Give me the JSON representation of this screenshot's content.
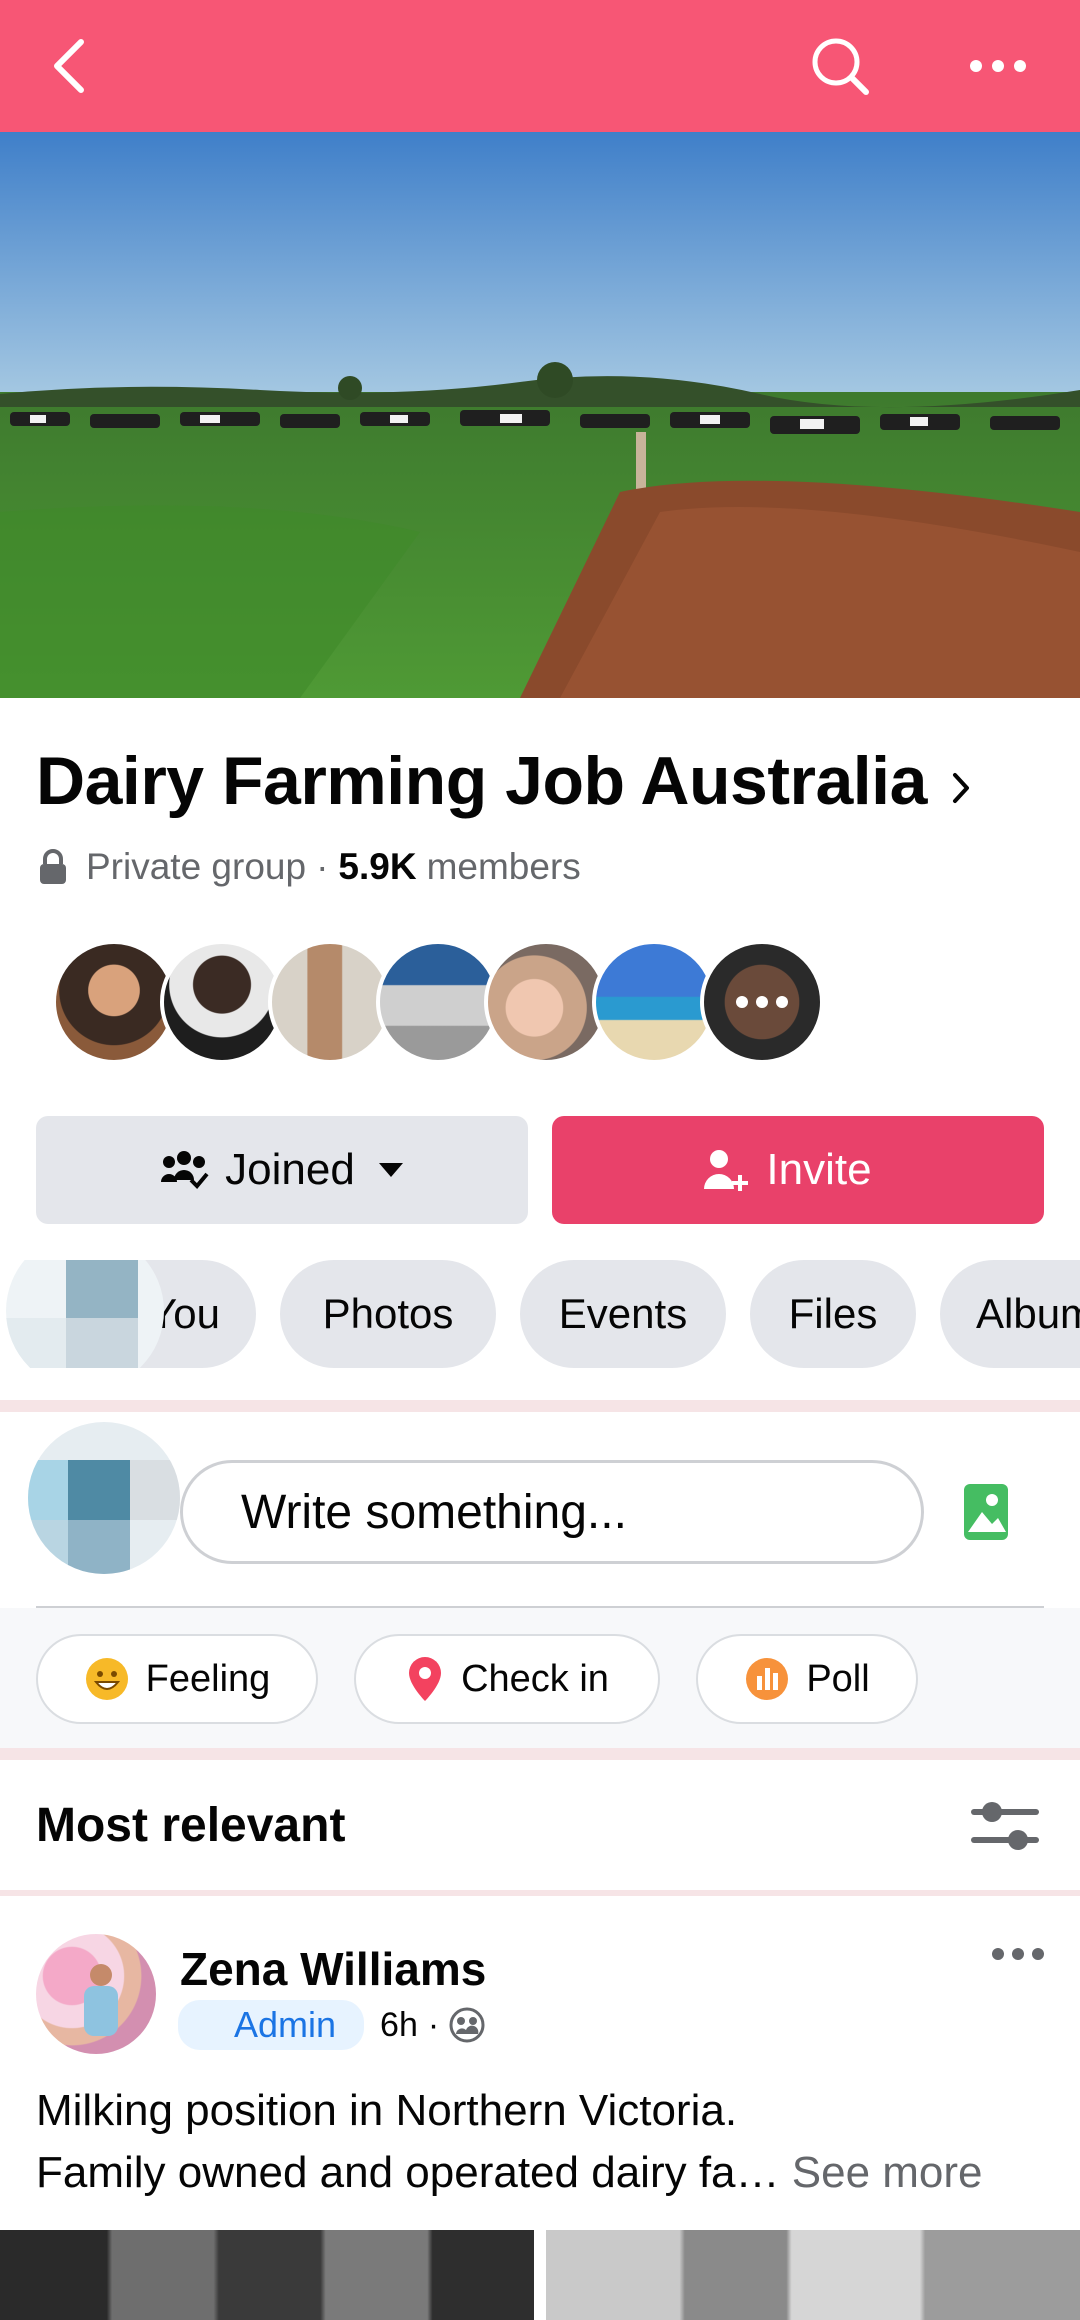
{
  "topbar": {
    "back_icon": "back-arrow-icon",
    "search_icon": "search-icon",
    "more_icon": "more-dots-icon",
    "color": "#f75675"
  },
  "group": {
    "name": "Dairy Farming Job Australia",
    "privacy": "Private group",
    "separator": "·",
    "member_count": "5.9K",
    "members_label": "members"
  },
  "member_avatars": {
    "count_shown": 7,
    "more_icon": "more-dots-icon"
  },
  "actions": {
    "joined_label": "Joined",
    "invite_label": "Invite",
    "accent_color": "#e9416a"
  },
  "tabs": [
    {
      "label": "You"
    },
    {
      "label": "Photos"
    },
    {
      "label": "Events"
    },
    {
      "label": "Files"
    },
    {
      "label": "Albums"
    }
  ],
  "composer": {
    "placeholder": "Write something..."
  },
  "post_actions": [
    {
      "label": "Feeling",
      "icon": "smiley-icon"
    },
    {
      "label": "Check in",
      "icon": "location-pin-icon"
    },
    {
      "label": "Poll",
      "icon": "poll-icon"
    }
  ],
  "feed": {
    "sort_label": "Most relevant",
    "filter_icon": "sliders-icon"
  },
  "post": {
    "author": "Zena Williams",
    "badge": "Admin",
    "time": "6h",
    "separator": "·",
    "audience_icon": "group-icon",
    "line1": "Milking position in Northern Victoria.",
    "line2": "Family owned and operated dairy fa…",
    "see_more": "See more"
  }
}
